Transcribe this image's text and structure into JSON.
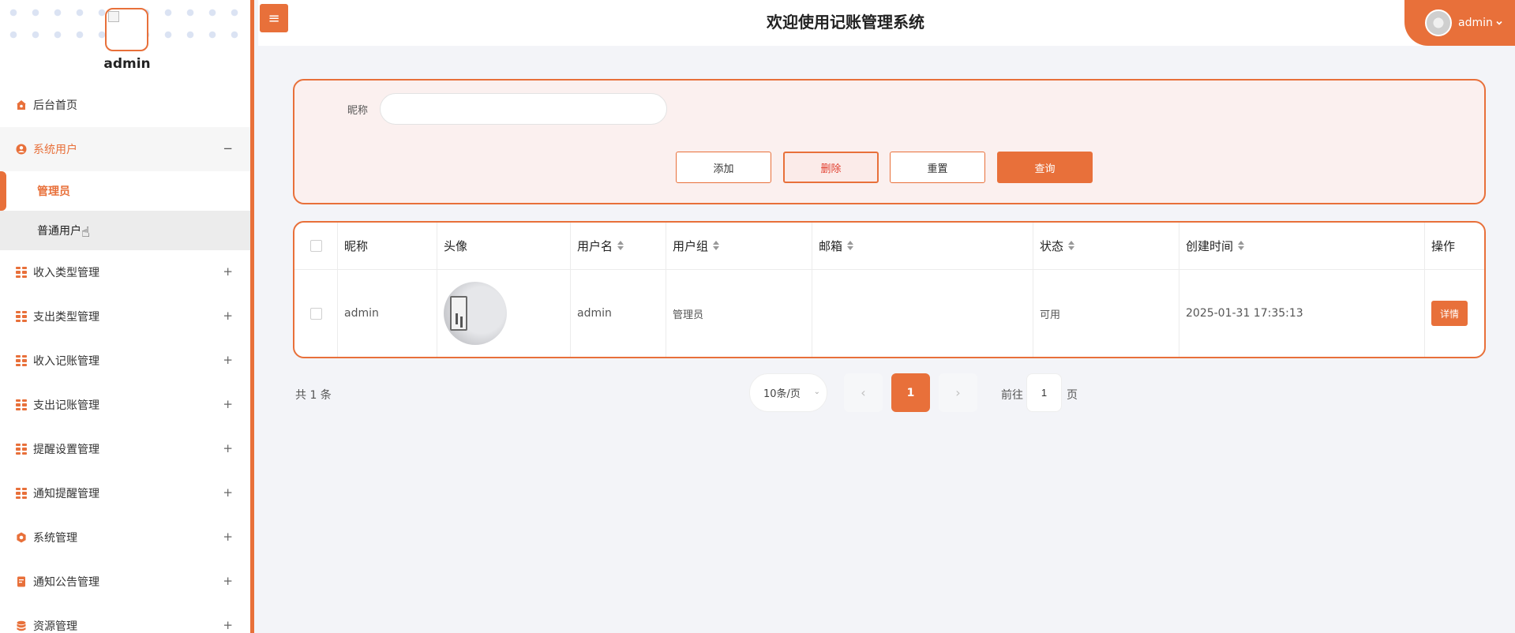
{
  "sidebar": {
    "username": "admin",
    "items": [
      {
        "label": "后台首页",
        "icon": "home-icon"
      },
      {
        "label": "系统用户",
        "icon": "user-circle-icon",
        "toggle": "−",
        "children": [
          {
            "label": "管理员"
          },
          {
            "label": "普通用户"
          }
        ]
      },
      {
        "label": "收入类型管理",
        "icon": "grid-icon",
        "toggle": "+"
      },
      {
        "label": "支出类型管理",
        "icon": "grid-icon",
        "toggle": "+"
      },
      {
        "label": "收入记账管理",
        "icon": "grid-icon",
        "toggle": "+"
      },
      {
        "label": "支出记账管理",
        "icon": "grid-icon",
        "toggle": "+"
      },
      {
        "label": "提醒设置管理",
        "icon": "grid-icon",
        "toggle": "+"
      },
      {
        "label": "通知提醒管理",
        "icon": "grid-icon",
        "toggle": "+"
      },
      {
        "label": "系统管理",
        "icon": "gear-icon",
        "toggle": "+"
      },
      {
        "label": "通知公告管理",
        "icon": "document-icon",
        "toggle": "+"
      },
      {
        "label": "资源管理",
        "icon": "database-icon",
        "toggle": "+"
      }
    ]
  },
  "header": {
    "menu_glyph": "≡",
    "title": "欢迎使用记账管理系统",
    "user": "admin"
  },
  "search": {
    "label": "昵称",
    "value": "",
    "placeholder": "",
    "buttons": {
      "add": "添加",
      "delete": "删除",
      "reset": "重置",
      "query": "查询"
    }
  },
  "table": {
    "columns": [
      "昵称",
      "头像",
      "用户名",
      "用户组",
      "邮箱",
      "状态",
      "创建时间",
      "操作"
    ],
    "rows": [
      {
        "nickname": "admin",
        "username": "admin",
        "group": "管理员",
        "email": "",
        "status": "可用",
        "created": "2025-01-31 17:35:13",
        "action": "详情"
      }
    ]
  },
  "pagination": {
    "total": "共 1 条",
    "page_size": "10条/页",
    "prev": "‹",
    "current": "1",
    "next": "›",
    "goto_label": "前往",
    "goto_value": "1",
    "page_suffix": "页"
  },
  "colors": {
    "accent": "#e8703a",
    "danger": "#e13f2f",
    "panel_bg": "#fbf0ef",
    "page_bg": "#f3f4f8"
  }
}
